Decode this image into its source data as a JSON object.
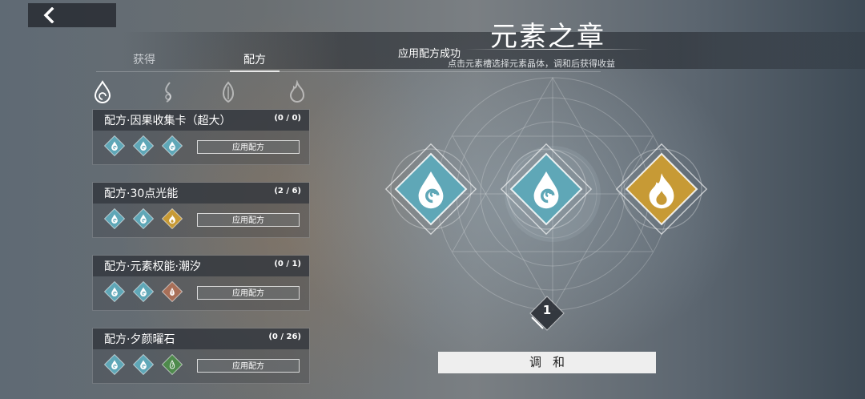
{
  "header": {
    "title": "元素之章",
    "toast": "应用配方成功",
    "subtitle": "点击元素槽选择元素晶体，调和后获得收益"
  },
  "tabs": [
    {
      "label": "获得",
      "active": false
    },
    {
      "label": "配方",
      "active": true
    }
  ],
  "element_filters": [
    "water-icon",
    "wind-icon",
    "nature-icon",
    "fire-icon"
  ],
  "recipes": [
    {
      "name": "配方·因果收集卡（超大）",
      "count": "(0 / 0)",
      "gems": [
        "water",
        "water",
        "water"
      ],
      "button": "应用配方"
    },
    {
      "name": "配方·30点光能",
      "count": "(2 / 6)",
      "gems": [
        "water",
        "water",
        "fire"
      ],
      "button": "应用配方"
    },
    {
      "name": "配方·元素权能·潮汐",
      "count": "(0 / 1)",
      "gems": [
        "water",
        "water",
        "earth"
      ],
      "button": "应用配方"
    },
    {
      "name": "配方·夕颜曜石",
      "count": "(0 / 26)",
      "gems": [
        "water",
        "water",
        "nature"
      ],
      "button": "应用配方"
    }
  ],
  "slots": [
    "water",
    "water",
    "fire"
  ],
  "quantity": "1",
  "harmonize_button": "调和",
  "colors": {
    "water": "#5fa7b7",
    "fire": "#c79a35",
    "earth": "#a86f58",
    "nature": "#4e8a4c"
  }
}
